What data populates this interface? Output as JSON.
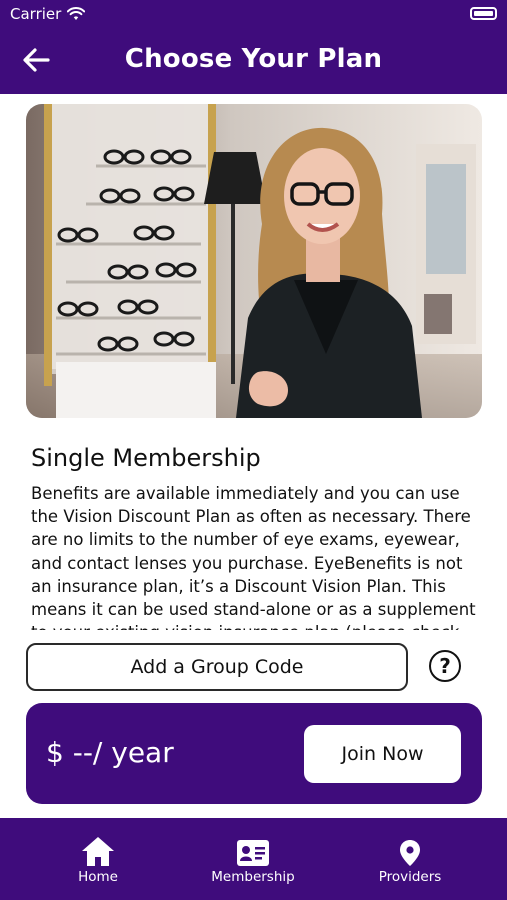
{
  "status_bar": {
    "carrier": "Carrier"
  },
  "header": {
    "title": "Choose Your Plan"
  },
  "plan": {
    "title": "Single Membership",
    "description": "Benefits are available immediately and you can use the Vision Discount Plan as often as necessary. There are no limits to the number of eye exams, eyewear, and contact lenses you purchase. EyeBenefits is not an insurance plan, it’s a Discount Vision Plan. This means it can be used stand-alone or as a supplement to your existing vision insurance plan (please check"
  },
  "group_code": {
    "label": "Add a Group Code",
    "help_symbol": "?"
  },
  "price_card": {
    "price": "$ --/ year",
    "join_label": "Join Now"
  },
  "tabs": [
    {
      "label": "Home",
      "icon": "home-icon"
    },
    {
      "label": "Membership",
      "icon": "id-card-icon"
    },
    {
      "label": "Providers",
      "icon": "map-pin-icon"
    }
  ],
  "colors": {
    "brand": "#3f0c7c",
    "surface": "#ffffff",
    "text": "#111111"
  }
}
